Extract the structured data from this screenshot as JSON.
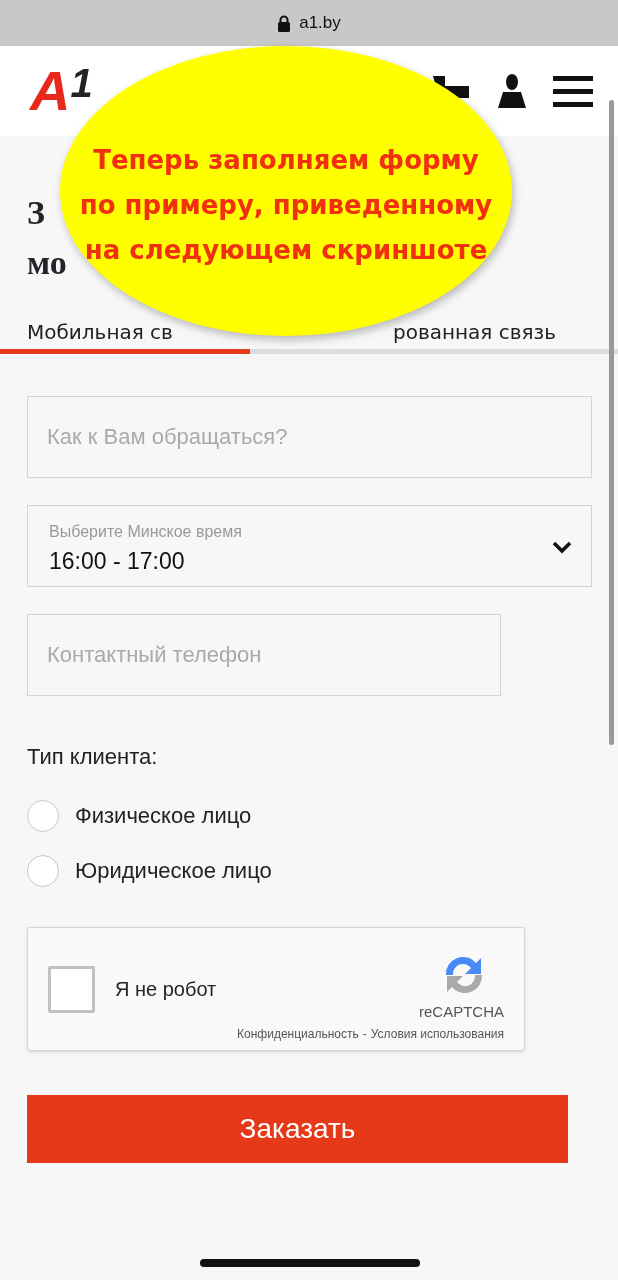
{
  "browser": {
    "url": "a1.by"
  },
  "header": {
    "logo": {
      "letter": "A",
      "digit": "1"
    }
  },
  "heading": {
    "lines": [
      "З",
      "мо"
    ]
  },
  "tabs": [
    {
      "label": "Мобильная св",
      "selected": true
    },
    {
      "label": "рованная связь",
      "selected": false
    }
  ],
  "form": {
    "name_field": {
      "placeholder": "Как к Вам обращаться?"
    },
    "time_select": {
      "label": "Выберите Минское время",
      "value": "16:00 - 17:00"
    },
    "phone_field": {
      "placeholder": "Контактный телефон"
    },
    "client_type": {
      "label": "Тип клиента:",
      "options": [
        {
          "label": "Физическое лицо",
          "selected": false
        },
        {
          "label": "Юридическое лицо",
          "selected": false
        }
      ]
    },
    "captcha": {
      "label": "Я не робот",
      "checked": false,
      "brand": "reCAPTCHA",
      "privacy": "Конфиденциальность",
      "separator": "-",
      "terms": "Условия использования"
    },
    "submit": "Заказать"
  },
  "annotation": {
    "lines": [
      "Теперь заполняем форму",
      "по примеру, приведенному",
      "на следующем скриншоте"
    ]
  }
}
